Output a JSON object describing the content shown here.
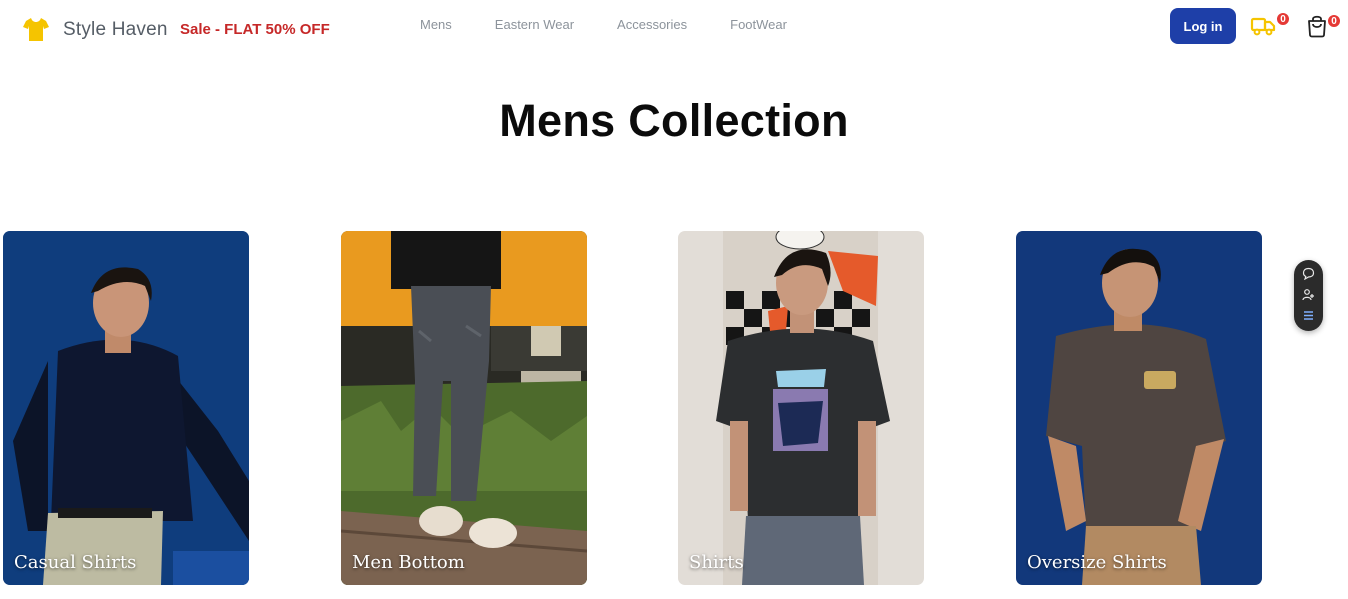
{
  "header": {
    "brand": "Style Haven",
    "sale": "Sale - FLAT 50% OFF",
    "nav": [
      "Mens",
      "Eastern Wear",
      "Accessories",
      "FootWear"
    ],
    "login_label": "Log in",
    "order_count": "0",
    "cart_count": "0"
  },
  "main": {
    "title": "Mens Collection",
    "categories": [
      {
        "label": "Casual Shirts"
      },
      {
        "label": "Men Bottom"
      },
      {
        "label": "Shirts"
      },
      {
        "label": "Oversize Shirts"
      }
    ]
  },
  "colors": {
    "accent": "#1e3fa8",
    "sale": "#c62828",
    "badge": "#e53935",
    "logo": "#f5c400"
  },
  "icons": [
    "tshirt-icon",
    "delivery-truck-icon",
    "shopping-bag-icon",
    "chat-icon",
    "user-icon",
    "list-icon"
  ]
}
